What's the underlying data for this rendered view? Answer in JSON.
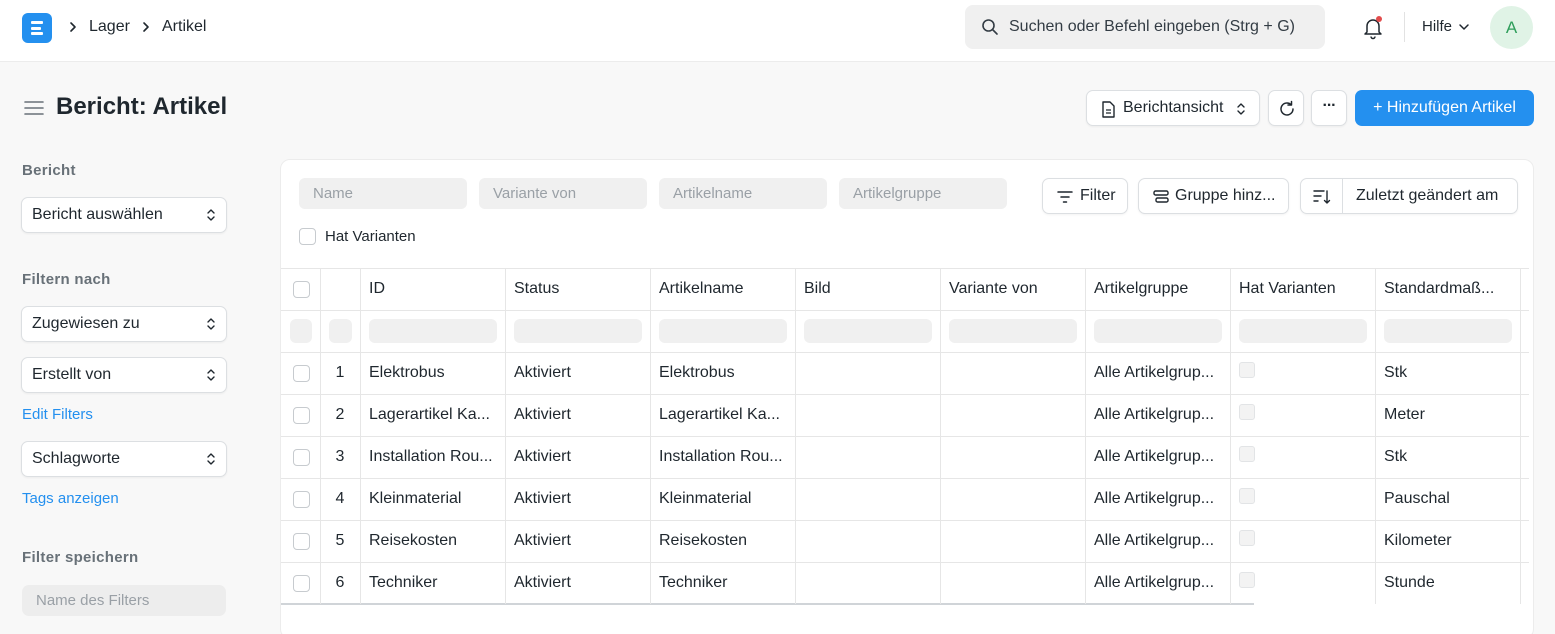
{
  "navbar": {
    "breadcrumbs": [
      "Lager",
      "Artikel"
    ],
    "search_placeholder": "Suchen oder Befehl eingeben (Strg + G)",
    "help_label": "Hilfe",
    "avatar_initial": "A"
  },
  "page": {
    "title": "Bericht: Artikel",
    "view_switcher_label": "Berichtansicht",
    "more_label": "···",
    "add_button_label": "+ Hinzufügen Artikel"
  },
  "sidebar": {
    "report_label": "Bericht",
    "report_select": "Bericht auswählen",
    "filter_by_label": "Filtern nach",
    "assigned_to": "Zugewiesen zu",
    "created_by": "Erstellt von",
    "edit_filters": "Edit Filters",
    "tags_select": "Schlagworte",
    "show_tags": "Tags anzeigen",
    "save_filter_label": "Filter speichern",
    "filter_name_placeholder": "Name des Filters"
  },
  "filters": {
    "name_placeholder": "Name",
    "variant_of_placeholder": "Variante von",
    "item_name_placeholder": "Artikelname",
    "item_group_placeholder": "Artikelgruppe",
    "has_variants_label": "Hat Varianten",
    "filter_button": "Filter",
    "group_by_button": "Gruppe hinz...",
    "sort_label": "Zuletzt geändert am"
  },
  "table": {
    "columns": [
      "ID",
      "Status",
      "Artikelname",
      "Bild",
      "Variante von",
      "Artikelgruppe",
      "Hat Varianten",
      "Standardmaß..."
    ],
    "rows": [
      {
        "n": "1",
        "id": "Elektrobus",
        "status": "Aktiviert",
        "name": "Elektrobus",
        "image": "",
        "variant_of": "",
        "group": "Alle Artikelgrup...",
        "uom": "Stk"
      },
      {
        "n": "2",
        "id": "Lagerartikel Ka...",
        "status": "Aktiviert",
        "name": "Lagerartikel Ka...",
        "image": "",
        "variant_of": "",
        "group": "Alle Artikelgrup...",
        "uom": "Meter"
      },
      {
        "n": "3",
        "id": "Installation Rou...",
        "status": "Aktiviert",
        "name": "Installation Rou...",
        "image": "",
        "variant_of": "",
        "group": "Alle Artikelgrup...",
        "uom": "Stk"
      },
      {
        "n": "4",
        "id": "Kleinmaterial",
        "status": "Aktiviert",
        "name": "Kleinmaterial",
        "image": "",
        "variant_of": "",
        "group": "Alle Artikelgrup...",
        "uom": "Pauschal"
      },
      {
        "n": "5",
        "id": "Reisekosten",
        "status": "Aktiviert",
        "name": "Reisekosten",
        "image": "",
        "variant_of": "",
        "group": "Alle Artikelgrup...",
        "uom": "Kilometer"
      },
      {
        "n": "6",
        "id": "Techniker",
        "status": "Aktiviert",
        "name": "Techniker",
        "image": "",
        "variant_of": "",
        "group": "Alle Artikelgrup...",
        "uom": "Stunde"
      }
    ]
  },
  "colors": {
    "primary": "#2490ef",
    "text": "#1f272e",
    "muted": "#687178",
    "border": "#e6e6e6"
  },
  "icons": [
    "app-logo-icon",
    "chevron-right-icon",
    "search-icon",
    "bell-icon",
    "chevron-down-icon",
    "hamburger-icon",
    "document-icon",
    "select-arrows-icon",
    "refresh-icon",
    "filter-icon",
    "group-icon",
    "sort-icon"
  ]
}
